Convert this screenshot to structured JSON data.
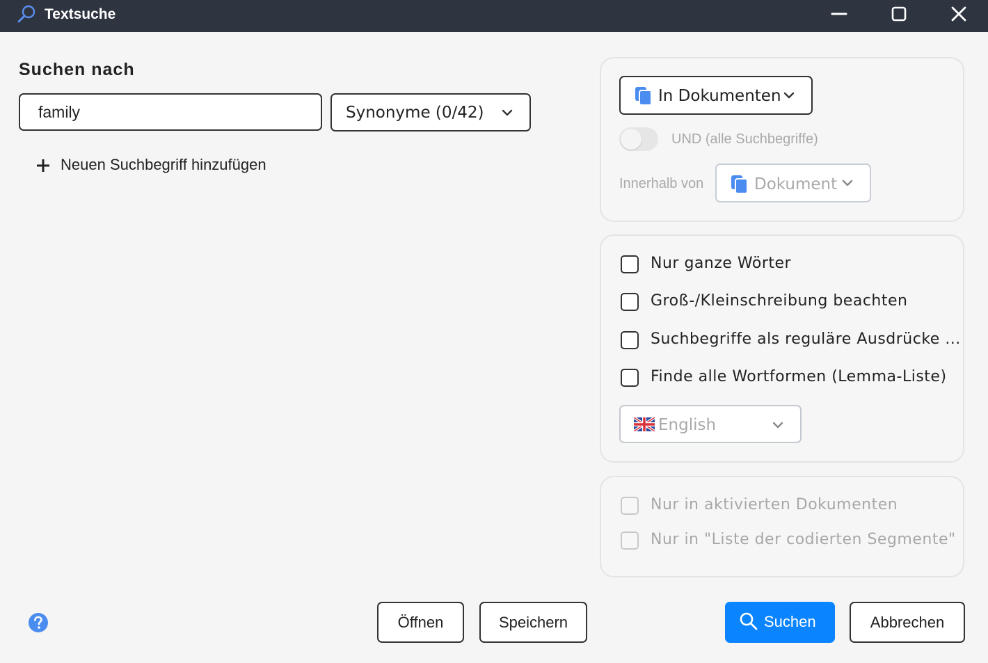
{
  "window": {
    "title": "Textsuche",
    "colors": {
      "titlebar": "#2e3440",
      "accent": "#0a84ff",
      "doc_icon": "#4a8cf0"
    }
  },
  "search": {
    "heading": "Suchen nach",
    "term_value": "family",
    "synonyms_label": "Synonyme (0/42)",
    "add_term_label": "Neuen Suchbegriff hinzufügen"
  },
  "scope": {
    "dropdown_label": "In Dokumenten",
    "and_toggle_label": "UND (alle Suchbegriffe)",
    "within_label": "Innerhalb von",
    "within_value": "Dokument"
  },
  "options": {
    "items": [
      {
        "label": "Nur ganze Wörter",
        "checked": false
      },
      {
        "label": "Groß-/Kleinschreibung beachten",
        "checked": false
      },
      {
        "label": "Suchbegriffe als reguläre Ausdrücke ...",
        "checked": false
      },
      {
        "label": "Finde alle Wortformen (Lemma-Liste)",
        "checked": false
      }
    ],
    "language_value": "English"
  },
  "restrictions": {
    "items": [
      {
        "label": "Nur in aktivierten Dokumenten",
        "checked": false,
        "enabled": false
      },
      {
        "label": "Nur in \"Liste der codierten Segmente\"",
        "checked": false,
        "enabled": false
      }
    ]
  },
  "footer": {
    "open_label": "Öffnen",
    "save_label": "Speichern",
    "search_label": "Suchen",
    "cancel_label": "Abbrechen"
  }
}
